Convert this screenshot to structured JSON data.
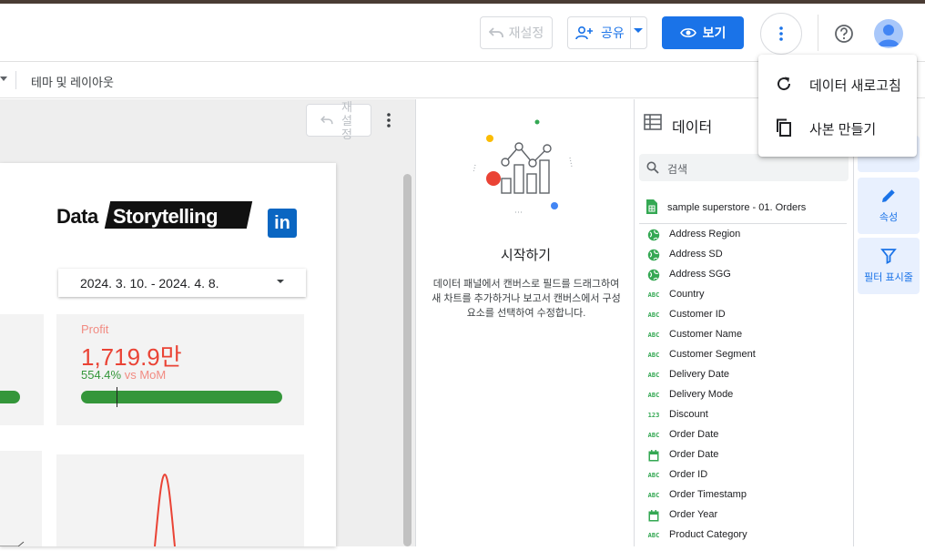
{
  "header": {
    "reset_label": "재설정",
    "share_label": "공유",
    "view_label": "보기"
  },
  "toolbar": {
    "theme_label": "테마 및 레이아웃"
  },
  "canvas": {
    "reset_label_line1": "재설",
    "reset_label_line2": "정",
    "logo_part1": "Data",
    "logo_part2": "Storytelling",
    "linkedin_label": "in",
    "date_range": "2024. 3. 10. - 2024. 4. 8.",
    "profit": {
      "label": "Profit",
      "value": "1,719.9만",
      "delta_pct": "554.4%",
      "delta_vs": "vs MoM"
    }
  },
  "start_panel": {
    "title": "시작하기",
    "description": "데이터 패널에서 캔버스로 필드를 드래그하여 새 차트를 추가하거나 보고서 캔버스에서 구성요소를 선택하여 수정합니다."
  },
  "data_panel": {
    "title": "데이터",
    "search_placeholder": "검색",
    "source_name": "sample superstore - 01. Orders",
    "fields": [
      {
        "type": "geo",
        "name": "Address Region"
      },
      {
        "type": "geo",
        "name": "Address SD"
      },
      {
        "type": "geo",
        "name": "Address SGG"
      },
      {
        "type": "text",
        "name": "Country"
      },
      {
        "type": "text",
        "name": "Customer ID"
      },
      {
        "type": "text",
        "name": "Customer Name"
      },
      {
        "type": "text",
        "name": "Customer Segment"
      },
      {
        "type": "text",
        "name": "Delivery Date"
      },
      {
        "type": "text",
        "name": "Delivery Mode"
      },
      {
        "type": "number",
        "name": "Discount"
      },
      {
        "type": "text",
        "name": "Order Date"
      },
      {
        "type": "date",
        "name": "Order Date"
      },
      {
        "type": "text",
        "name": "Order ID"
      },
      {
        "type": "text",
        "name": "Order Timestamp"
      },
      {
        "type": "date",
        "name": "Order Year"
      },
      {
        "type": "text",
        "name": "Product Category"
      }
    ],
    "type_badges": {
      "text": "ABC",
      "number": "123"
    }
  },
  "right_rail": {
    "properties_label": "속성",
    "filter_label": "필터 표시줄"
  },
  "menu": {
    "refresh_label": "데이터 새로고침",
    "copy_label": "사본 만들기"
  },
  "colors": {
    "accent": "#1a73e8",
    "profit_red": "#ea4335",
    "positive_green": "#34963a"
  }
}
